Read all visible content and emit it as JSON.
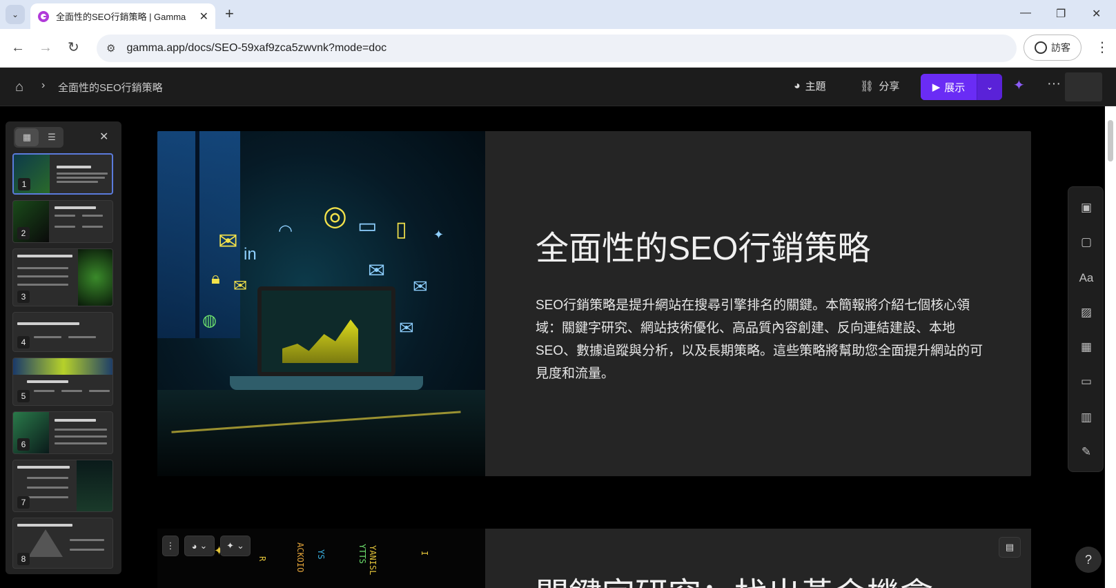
{
  "browser": {
    "tab_title": "全面性的SEO行銷策略 | Gamma",
    "url": "gamma.app/docs/SEO-59xaf9zca5zwvnk?mode=doc",
    "guest_label": "訪客"
  },
  "toolbar": {
    "breadcrumb_title": "全面性的SEO行銷策略",
    "theme_label": "主題",
    "share_label": "分享",
    "present_label": "展示"
  },
  "thumbnails": [
    {
      "number": "1",
      "active": true
    },
    {
      "number": "2"
    },
    {
      "number": "3"
    },
    {
      "number": "4"
    },
    {
      "number": "5"
    },
    {
      "number": "6"
    },
    {
      "number": "7"
    },
    {
      "number": "8"
    }
  ],
  "slide1": {
    "title": "全面性的SEO行銷策略",
    "body": "SEO行銷策略是提升網站在搜尋引擎排名的關鍵。本簡報將介紹七個核心領域：關鍵字研究、網站技術優化、高品質內容創建、反向連結建設、本地SEO、數據追蹤與分析，以及長期策略。這些策略將幫助您全面提升網站的可見度和流量。"
  },
  "slide2": {
    "title": "關鍵字研究：找出黃金機會"
  },
  "help_label": "?",
  "colors": {
    "accent": "#6a2cf5",
    "toolbar_bg": "#1c1c1c",
    "card_bg": "#252525"
  }
}
